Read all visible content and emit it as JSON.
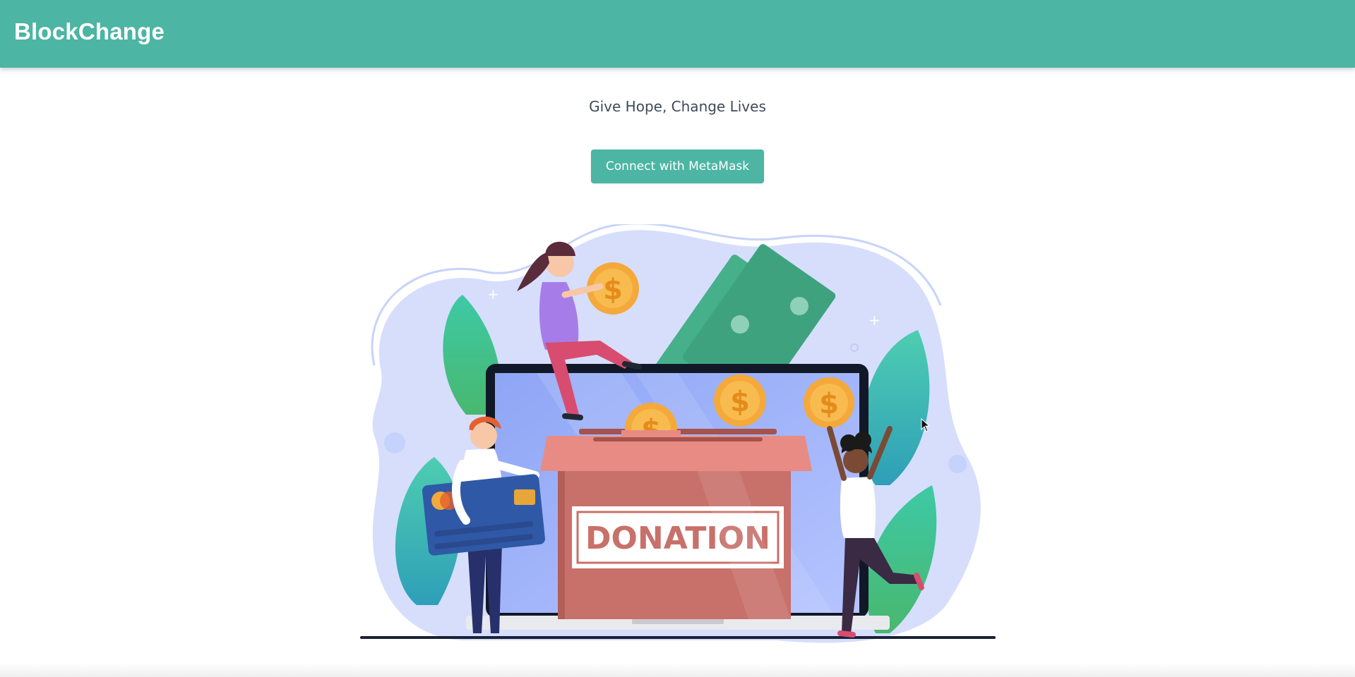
{
  "header": {
    "brand": "BlockChange"
  },
  "hero": {
    "tagline": "Give Hope, Change Lives",
    "connect_button_label": "Connect with MetaMask"
  },
  "illustration": {
    "box_label": "DONATION",
    "coin_symbol": "$"
  },
  "colors": {
    "brand": "#4cb5a3",
    "box": "#c8706a",
    "money": "#4aaf8c",
    "coin": "#f4a93a",
    "card": "#2f59a6"
  }
}
